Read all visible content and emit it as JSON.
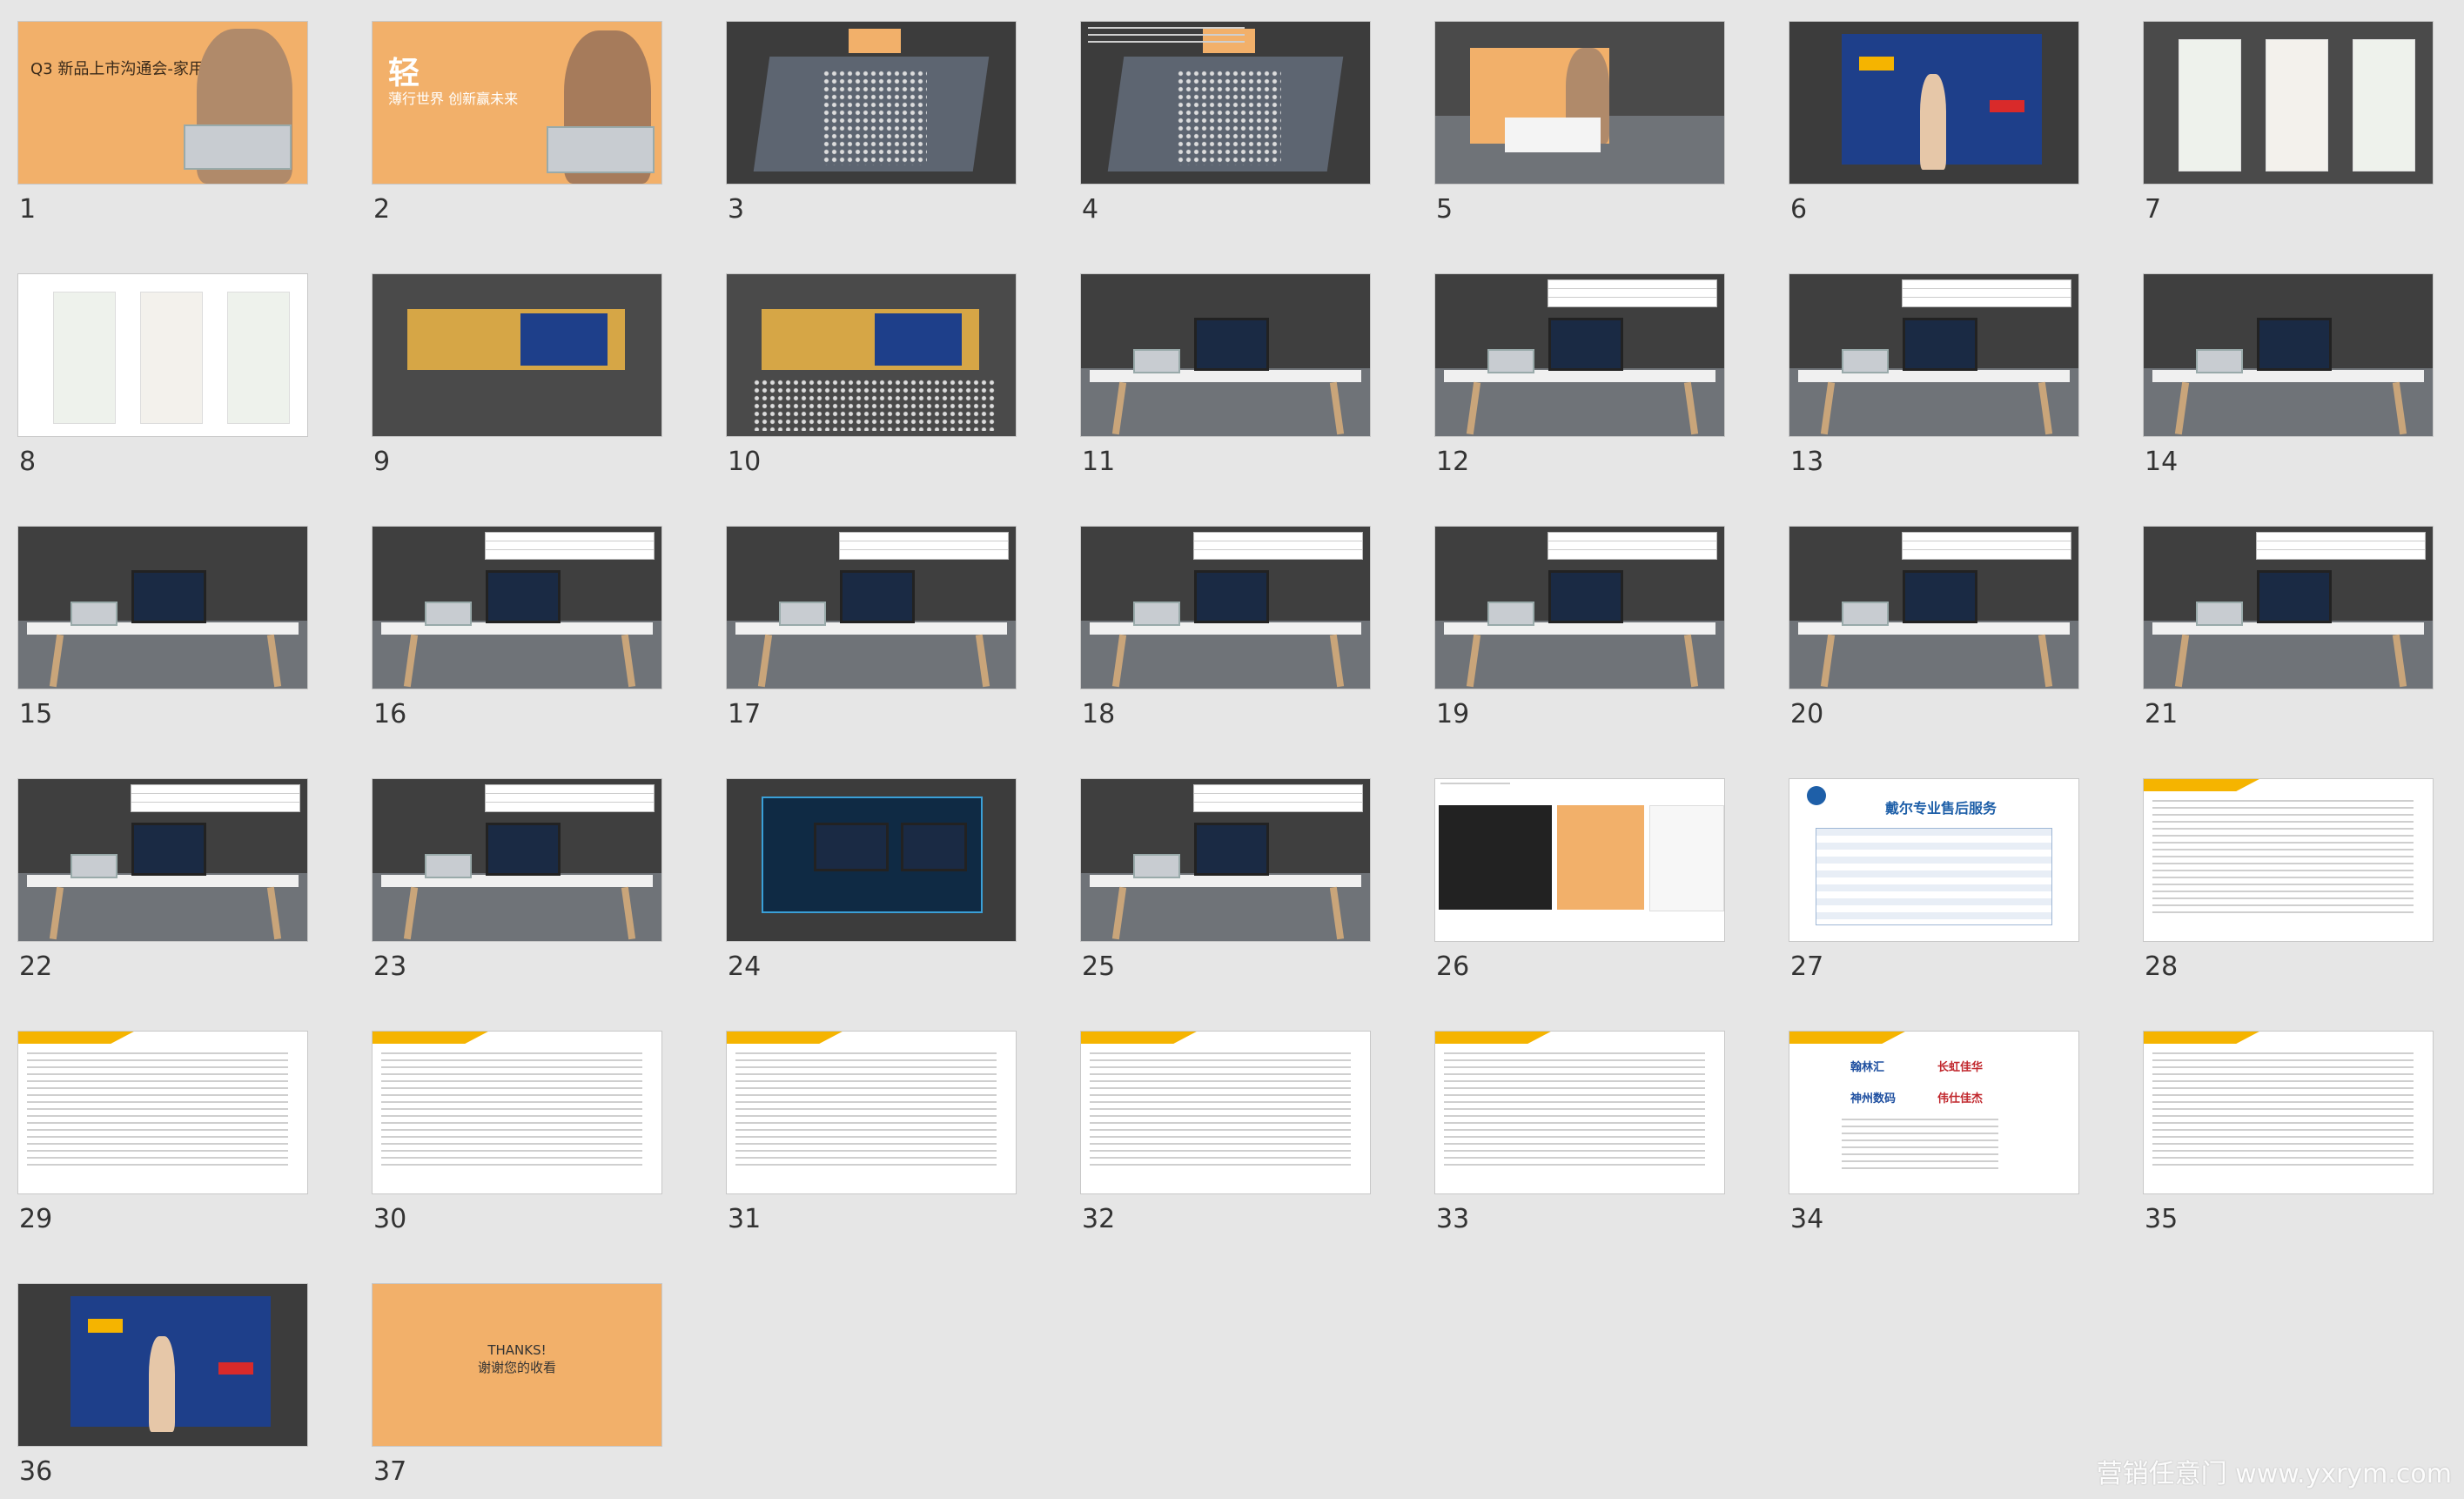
{
  "colors": {
    "page_background": "#e6e6e6",
    "accent_orange": "#f2b06a",
    "accent_yellow": "#f5b400",
    "dark_slide": "#4a4a4a",
    "brand_blue": "#1e3f8a"
  },
  "slides": [
    {
      "number": "1",
      "style": "cover",
      "title": "Q3 新品上市沟通会-家用"
    },
    {
      "number": "2",
      "style": "hero",
      "headline": "轻",
      "subline": "薄行世界 创新赢未来"
    },
    {
      "number": "3",
      "style": "venue"
    },
    {
      "number": "4",
      "style": "venue-notes"
    },
    {
      "number": "5",
      "style": "backdrop"
    },
    {
      "number": "6",
      "style": "blue-wall"
    },
    {
      "number": "7",
      "style": "posters"
    },
    {
      "number": "8",
      "style": "posters-light"
    },
    {
      "number": "9",
      "style": "stage"
    },
    {
      "number": "10",
      "style": "stage-seats"
    },
    {
      "number": "11",
      "style": "desk"
    },
    {
      "number": "12",
      "style": "desk-table"
    },
    {
      "number": "13",
      "style": "desk-table"
    },
    {
      "number": "14",
      "style": "desk"
    },
    {
      "number": "15",
      "style": "desk"
    },
    {
      "number": "16",
      "style": "desk-table"
    },
    {
      "number": "17",
      "style": "desk-table"
    },
    {
      "number": "18",
      "style": "desk-table"
    },
    {
      "number": "19",
      "style": "desk-table"
    },
    {
      "number": "20",
      "style": "desk-table"
    },
    {
      "number": "21",
      "style": "desk-table"
    },
    {
      "number": "22",
      "style": "desk-table"
    },
    {
      "number": "23",
      "style": "desk-table"
    },
    {
      "number": "24",
      "style": "gaming"
    },
    {
      "number": "25",
      "style": "desk-table"
    },
    {
      "number": "26",
      "style": "doc-images"
    },
    {
      "number": "27",
      "style": "doc-service",
      "heading": "戴尔专业售后服务"
    },
    {
      "number": "28",
      "style": "doc-yellow"
    },
    {
      "number": "29",
      "style": "doc-yellow"
    },
    {
      "number": "30",
      "style": "doc-yellow"
    },
    {
      "number": "31",
      "style": "doc-yellow"
    },
    {
      "number": "32",
      "style": "doc-yellow"
    },
    {
      "number": "33",
      "style": "doc-yellow"
    },
    {
      "number": "34",
      "style": "doc-partners",
      "partners": [
        "翰林汇",
        "长虹佳华",
        "神州数码",
        "伟仕佳杰"
      ]
    },
    {
      "number": "35",
      "style": "doc-yellow"
    },
    {
      "number": "36",
      "style": "blue-wall"
    },
    {
      "number": "37",
      "style": "thanks",
      "line1": "THANKS!",
      "line2": "谢谢您的收看"
    }
  ],
  "watermark": "营销任意门 www.yxrym.com"
}
